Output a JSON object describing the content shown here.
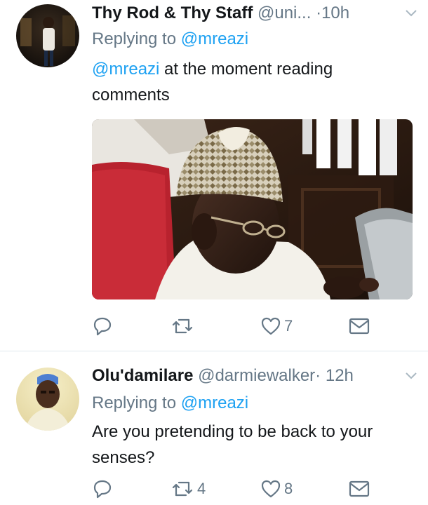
{
  "tweets": [
    {
      "display_name": "Thy Rod & Thy Staff",
      "handle": "@uni...",
      "separator": "·",
      "time": "10h",
      "replying_prefix": "Replying to ",
      "replying_to": "@mreazi",
      "text_mention": "@mreazi",
      "text": " at the moment reading comments",
      "actions": {
        "reply_count": "",
        "retweet_count": "",
        "like_count": "7"
      },
      "has_media": true
    },
    {
      "display_name": "Olu'damilare",
      "handle": "@darmiewalker",
      "separator": "·",
      "time": "12h",
      "replying_prefix": "Replying to ",
      "replying_to": "@mreazi",
      "text_mention": "",
      "text": "Are you pretending to be back to your senses?",
      "actions": {
        "reply_count": "",
        "retweet_count": "4",
        "like_count": "8"
      },
      "has_media": false
    }
  ],
  "colors": {
    "text": "#14171a",
    "secondary": "#657786",
    "link": "#1da1f2",
    "divider": "#e1e8ed"
  },
  "icons": [
    "reply-icon",
    "retweet-icon",
    "like-icon",
    "direct-message-icon",
    "chevron-down-icon"
  ]
}
